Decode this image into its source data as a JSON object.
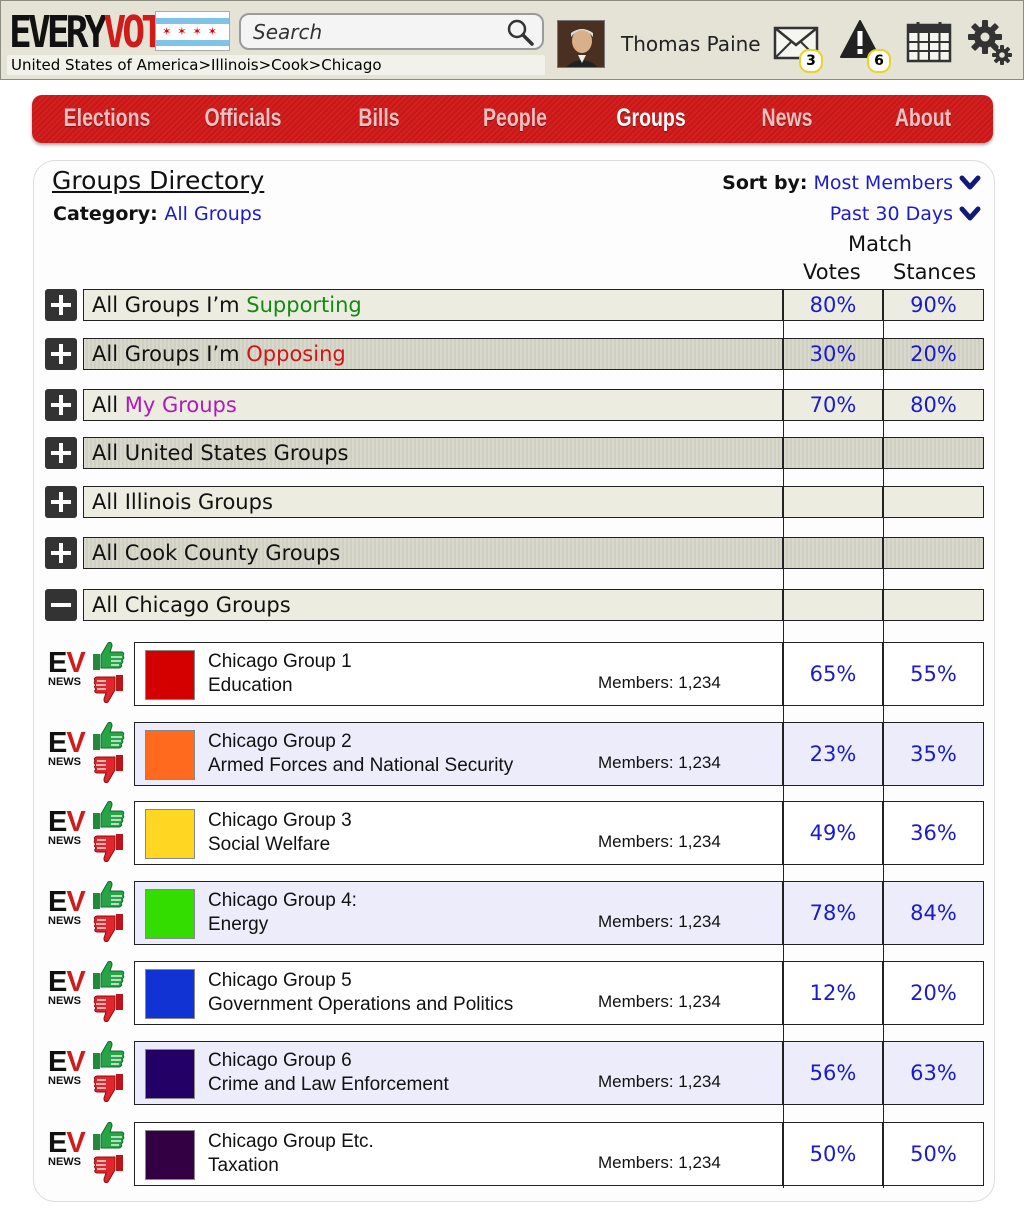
{
  "header": {
    "logo_every": "EVERY",
    "logo_vote": "VOTE",
    "flag_stars": "✶✶✶✶",
    "search_placeholder": "Search",
    "breadcrumb": "United States of America>Illinois>Cook>Chicago",
    "user_name": "Thomas Paine",
    "messages_count": "3",
    "alerts_count": "6"
  },
  "nav": {
    "items": [
      "Elections",
      "Officials",
      "Bills",
      "People",
      "Groups",
      "News",
      "About"
    ],
    "active": "Groups"
  },
  "directory": {
    "title": "Groups Directory",
    "category_label": "Category:",
    "category_value": "All Groups",
    "sort_label": "Sort by:",
    "sort_value": "Most Members",
    "period_value": "Past 30 Days",
    "col_match": "Match",
    "col_votes": "Votes",
    "col_stances": "Stances"
  },
  "categories": [
    {
      "prefix": "All Groups I’m ",
      "highlight": "Supporting",
      "suffix": "",
      "votes": "80%",
      "stances": "90%"
    },
    {
      "prefix": "All Groups I’m ",
      "highlight": "Opposing",
      "suffix": "",
      "votes": "30%",
      "stances": "20%"
    },
    {
      "prefix": "All ",
      "highlight": "My Groups",
      "suffix": "",
      "votes": "70%",
      "stances": "80%"
    },
    {
      "prefix": "All United States Groups",
      "highlight": "",
      "suffix": "",
      "votes": "",
      "stances": ""
    },
    {
      "prefix": "All Illinois Groups",
      "highlight": "",
      "suffix": "",
      "votes": "",
      "stances": ""
    },
    {
      "prefix": "All Cook County Groups",
      "highlight": "",
      "suffix": "",
      "votes": "",
      "stances": ""
    },
    {
      "prefix": "All Chicago Groups",
      "highlight": "",
      "suffix": "",
      "votes": "",
      "stances": ""
    }
  ],
  "ev_news": {
    "e": "E",
    "v": "V",
    "news": "NEWS"
  },
  "groups": [
    {
      "name": "Chicago Group 1",
      "category": "Education",
      "members": "Members: 1,234",
      "votes": "65%",
      "stances": "55%",
      "color": "#d40000"
    },
    {
      "name": "Chicago Group 2",
      "category": "Armed Forces and National Security",
      "members": "Members: 1,234",
      "votes": "23%",
      "stances": "35%",
      "color": "#ff6a1f"
    },
    {
      "name": "Chicago Group 3",
      "category": "Social Welfare",
      "members": "Members: 1,234",
      "votes": "49%",
      "stances": "36%",
      "color": "#ffd723"
    },
    {
      "name": "Chicago Group 4:",
      "category": "Energy",
      "members": "Members: 1,234",
      "votes": "78%",
      "stances": "84%",
      "color": "#33dd00"
    },
    {
      "name": "Chicago Group 5",
      "category": "Government Operations and Politics",
      "members": "Members: 1,234",
      "votes": "12%",
      "stances": "20%",
      "color": "#1133d4"
    },
    {
      "name": "Chicago Group 6",
      "category": "Crime and Law Enforcement",
      "members": "Members: 1,234",
      "votes": "56%",
      "stances": "63%",
      "color": "#220066"
    },
    {
      "name": "Chicago Group Etc.",
      "category": "Taxation",
      "members": "Members: 1,234",
      "votes": "50%",
      "stances": "50%",
      "color": "#330044"
    }
  ]
}
